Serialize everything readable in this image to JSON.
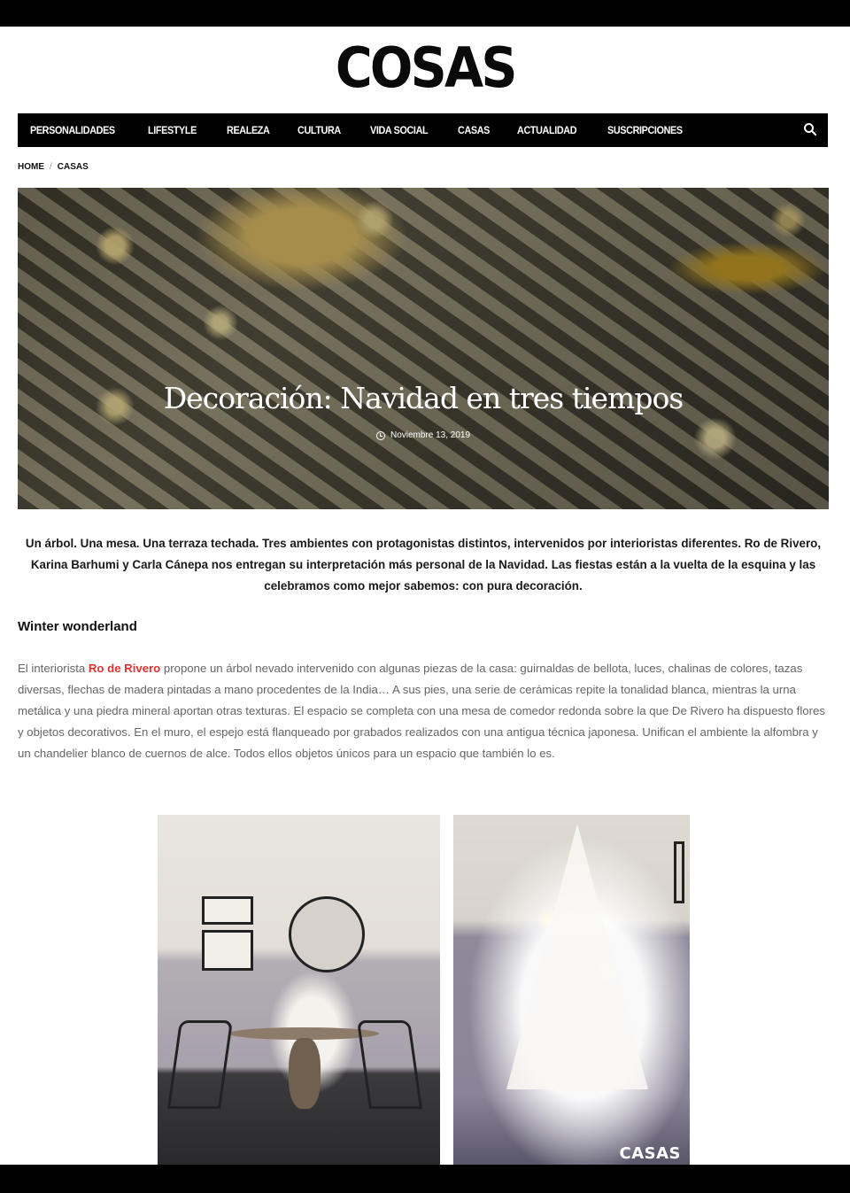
{
  "brand": {
    "logo": "COSAS"
  },
  "nav": {
    "items": [
      {
        "label": "PERSONALIDADES"
      },
      {
        "label": "LIFESTYLE"
      },
      {
        "label": "REALEZA"
      },
      {
        "label": "CULTURA"
      },
      {
        "label": "VIDA SOCIAL"
      },
      {
        "label": "CASAS"
      },
      {
        "label": "ACTUALIDAD"
      },
      {
        "label": "SUSCRIPCIONES"
      }
    ],
    "search_icon": "search-icon"
  },
  "breadcrumb": {
    "home": "HOME",
    "separator": "/",
    "current": "CASAS"
  },
  "hero": {
    "title": "Decoración: Navidad en tres tiempos",
    "date": "Noviembre 13, 2019",
    "date_icon": "clock-icon"
  },
  "article": {
    "intro": "Un árbol. Una mesa. Una terraza techada. Tres ambientes con protagonistas distintos, intervenidos por interioristas diferentes. Ro de Rivero, Karina Barhumi y Carla Cánepa nos entregan su interpretación más personal de la Navidad. Las fiestas están a la vuelta de la esquina y las celebramos como mejor sabemos: con pura decoración.",
    "section_title": "Winter wonderland",
    "body_prefix": "El interiorista ",
    "body_link": "Ro de Rivero",
    "body_rest": " propone un árbol nevado intervenido con algunas piezas de la casa: guirnaldas de bellota, luces, chalinas de colores, tazas diversas, flechas de madera pintadas a mano procedentes de la India… A sus pies, una serie de cerámicas repite la tonalidad blanca, mientras la urna metálica y una piedra mineral aportan otras texturas. El espacio se completa con una mesa de comedor redonda sobre la que De Rivero ha dispuesto flores y objetos decorativos. En el muro, el espejo está flanqueado por grabados realizados con una antigua técnica japonesa. Unifican el ambiente la alfombra y un chandelier blanco de cuernos de alce. Todos ellos objetos únicos para un espacio que también lo es."
  },
  "gallery": {
    "watermark": "CASAS"
  }
}
